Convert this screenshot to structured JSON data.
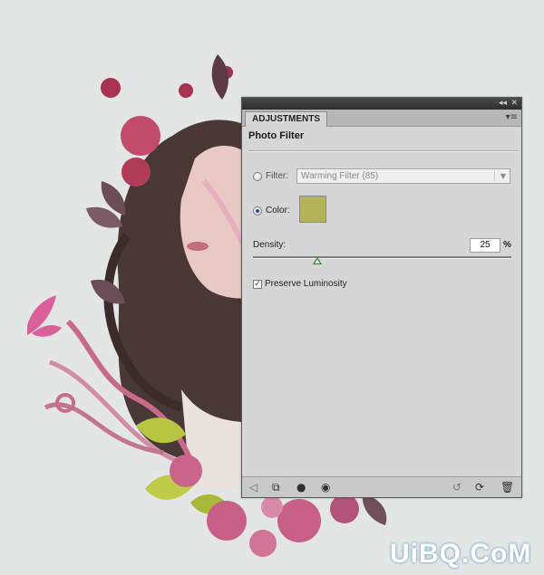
{
  "panel": {
    "tab_label": "ADJUSTMENTS",
    "title": "Photo Filter",
    "window_buttons": {
      "collapse": "◂◂",
      "close": "✕"
    },
    "menu_glyph": "▾≡",
    "filter": {
      "label": "Filter:",
      "value": "Warming Filter (85)",
      "selected": false
    },
    "color": {
      "label": "Color:",
      "selected": true,
      "swatch": "#b4b35a"
    },
    "density": {
      "label": "Density:",
      "value": "25",
      "unit": "%",
      "percent": 25
    },
    "preserve_luminosity": {
      "label": "Preserve Luminosity",
      "checked": true
    },
    "bottom_icons": [
      "back-arrow-icon",
      "clip-to-layer-icon",
      "layer-visibility-icon",
      "view-previous-icon",
      "previous-state-icon",
      "reset-icon",
      "trash-icon"
    ]
  },
  "watermark": "UiBQ.CoM",
  "colors": {
    "panel_bg": "#d6d6d6",
    "titlebar": "#2e2e2e",
    "slider_thumb": "#2f7a2f"
  }
}
